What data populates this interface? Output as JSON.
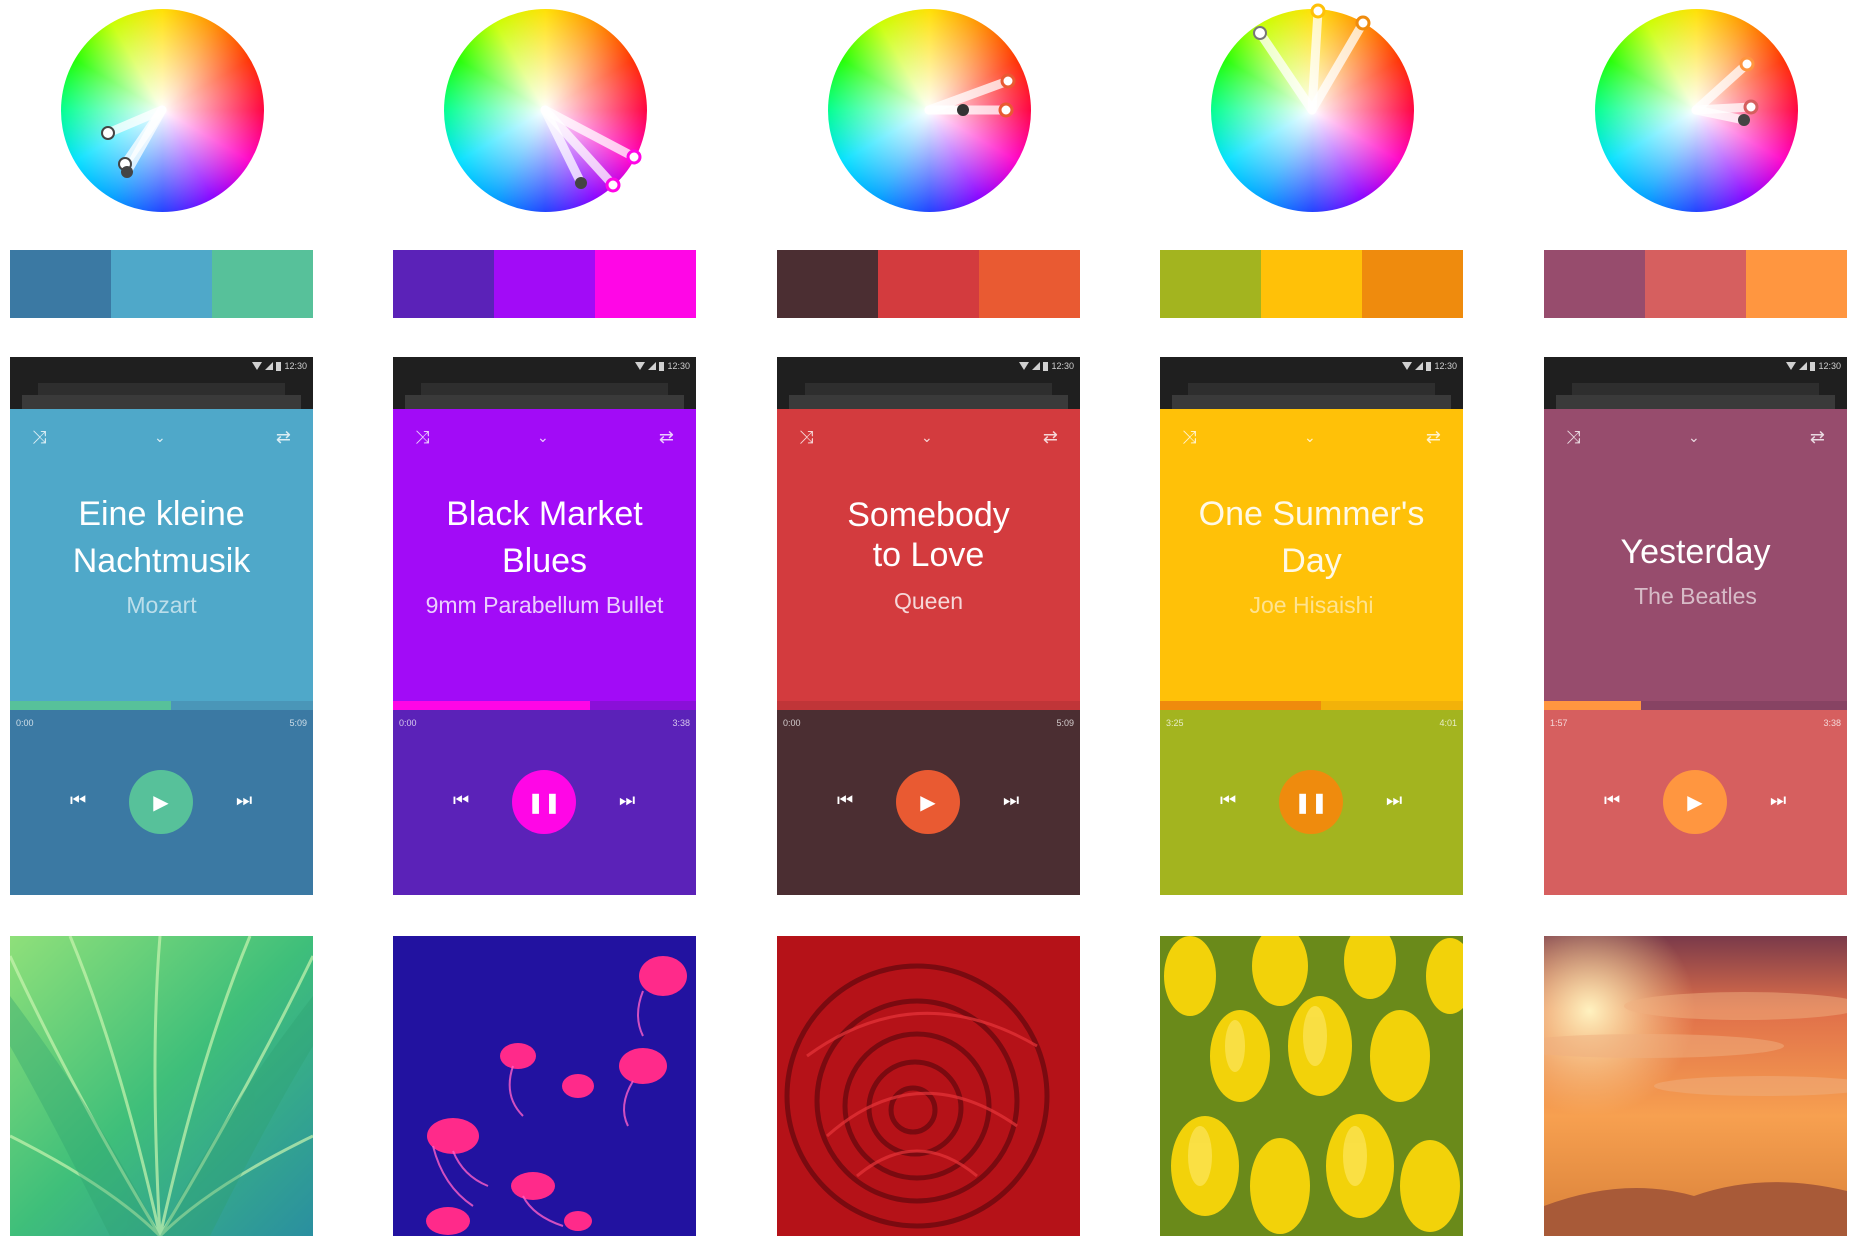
{
  "status_bar": {
    "time": "12:30"
  },
  "icons": {
    "shuffle": "shuffle-icon",
    "chevron": "chevron-down-icon",
    "repeat": "repeat-icon",
    "previous": "skip-previous-icon",
    "next": "skip-next-icon",
    "play": "play-icon",
    "pause": "pause-icon"
  },
  "columns": [
    {
      "palette": [
        "#3b79a3",
        "#4fa8c9",
        "#57c19a"
      ],
      "song": "Eine kleine Nachtmusik",
      "artist": "Mozart",
      "time_elapsed": "0:00",
      "time_total": "5:09",
      "progress": 0.53,
      "state": "play",
      "colors": {
        "header": "#4fa8c9",
        "controls": "#3b79a3",
        "accent": "#57c19a",
        "track": "#4a96b8"
      },
      "photo": "green-leaves"
    },
    {
      "palette": [
        "#5b22b8",
        "#a20bf7",
        "#ff06e6"
      ],
      "song": "Black Market Blues",
      "artist": "9mm Parabellum Bullet",
      "time_elapsed": "0:00",
      "time_total": "3:38",
      "progress": 0.65,
      "state": "pause",
      "colors": {
        "header": "#a20bf7",
        "controls": "#5b22b8",
        "accent": "#ff06e6",
        "track": "#8a10d8"
      },
      "photo": "jellyfish"
    },
    {
      "palette": [
        "#4b2e32",
        "#d33b3e",
        "#e95a32"
      ],
      "song": "Somebody to Love",
      "artist": "Queen",
      "time_elapsed": "0:00",
      "time_total": "5:09",
      "progress": 0.0,
      "state": "play",
      "colors": {
        "header": "#d33b3e",
        "controls": "#4b2e32",
        "accent": "#e95a32",
        "track": "#c03538"
      },
      "photo": "red-rose"
    },
    {
      "palette": [
        "#a3b41f",
        "#ffc108",
        "#ef8b0d"
      ],
      "song": "One Summer's Day",
      "artist": "Joe Hisaishi",
      "time_elapsed": "3:25",
      "time_total": "4:01",
      "progress": 0.53,
      "state": "pause",
      "colors": {
        "header": "#ffc108",
        "controls": "#a3b41f",
        "accent": "#ef8b0d",
        "track": "#f2b20a"
      },
      "photo": "yellow-tulips"
    },
    {
      "palette": [
        "#974c6d",
        "#d65f5f",
        "#ff9640"
      ],
      "song": "Yesterday",
      "artist": "The Beatles",
      "time_elapsed": "1:57",
      "time_total": "3:38",
      "progress": 0.32,
      "state": "play",
      "colors": {
        "header": "#974c6d",
        "controls": "#d65f5f",
        "accent": "#ff9640",
        "track": "#874363"
      },
      "photo": "sunset-sky"
    }
  ]
}
